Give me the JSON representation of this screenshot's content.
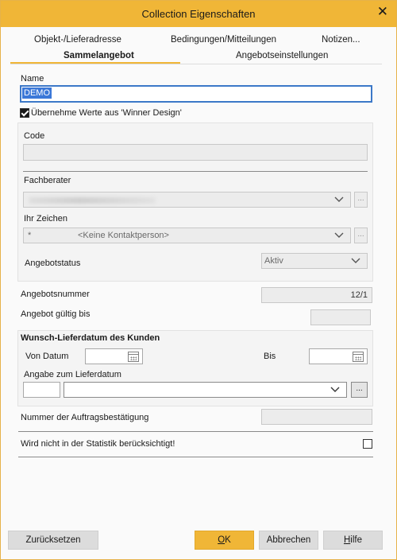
{
  "window": {
    "title": "Collection Eigenschaften",
    "close": "✕"
  },
  "tabs": {
    "row1": [
      "Objekt-/Lieferadresse",
      "Bedingungen/Mitteilungen",
      "Notizen..."
    ],
    "row2": [
      "Sammelangebot",
      "Angebotseinstellungen"
    ],
    "active": "Sammelangebot"
  },
  "form": {
    "name_label": "Name",
    "name_value": "DEMO",
    "winner_design_label": "Übernehme Werte aus 'Winner Design'",
    "winner_design_checked": true,
    "code_label": "Code",
    "code_value": "",
    "fachberater_label": "Fachberater",
    "ihr_zeichen_label": "Ihr Zeichen",
    "ihr_zeichen_prefix": "*",
    "ihr_zeichen_value": "<Keine Kontaktperson>",
    "angebotstatus_label": "Angebotstatus",
    "angebotstatus_value": "Aktiv",
    "angebotsnummer_label": "Angebotsnummer",
    "angebotsnummer_value": "12/1",
    "gueltig_label": "Angebot gültig bis",
    "gueltig_value": "",
    "wunsch_header": "Wunsch-Lieferdatum des Kunden",
    "von_datum_label": "Von Datum",
    "bis_label": "Bis",
    "angabe_label": "Angabe zum Lieferdatum",
    "auftrag_label": "Nummer der Auftragsbestätigung",
    "statistik_label": "Wird nicht in der Statistik berücksichtigt!",
    "statistik_checked": false,
    "ellipsis": "..."
  },
  "buttons": {
    "reset": "Zurücksetzen",
    "ok": "OK",
    "ok_mnemonic": "O",
    "ok_rest": "K",
    "cancel": "Abbrechen",
    "help_mnemonic": "H",
    "help_rest": "ilfe"
  },
  "colors": {
    "accent": "#f0b637",
    "focus": "#3c78c8"
  }
}
